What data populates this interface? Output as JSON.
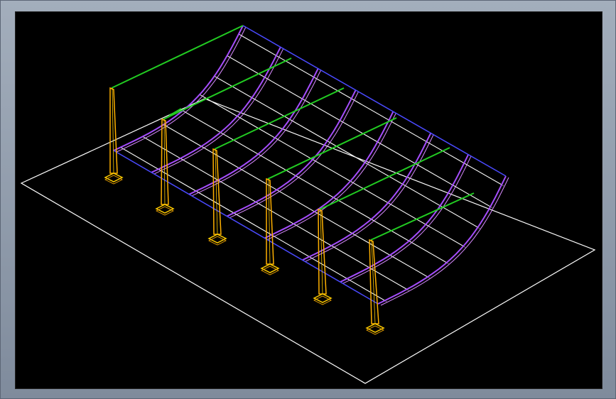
{
  "colors": {
    "background_frame": "#8e9aab",
    "viewport_bg": "#000000",
    "ground_line": "#ffffff",
    "rafter": "#a64dff",
    "rafter_highlight": "#d98cff",
    "purlin": "#ffffff",
    "tie_beam": "#22cc22",
    "edge_beam": "#4a4aff",
    "column": "#ffb000",
    "column_base": "#ffcc00"
  },
  "icons": {
    "model": "wireframe-canopy-icon"
  }
}
